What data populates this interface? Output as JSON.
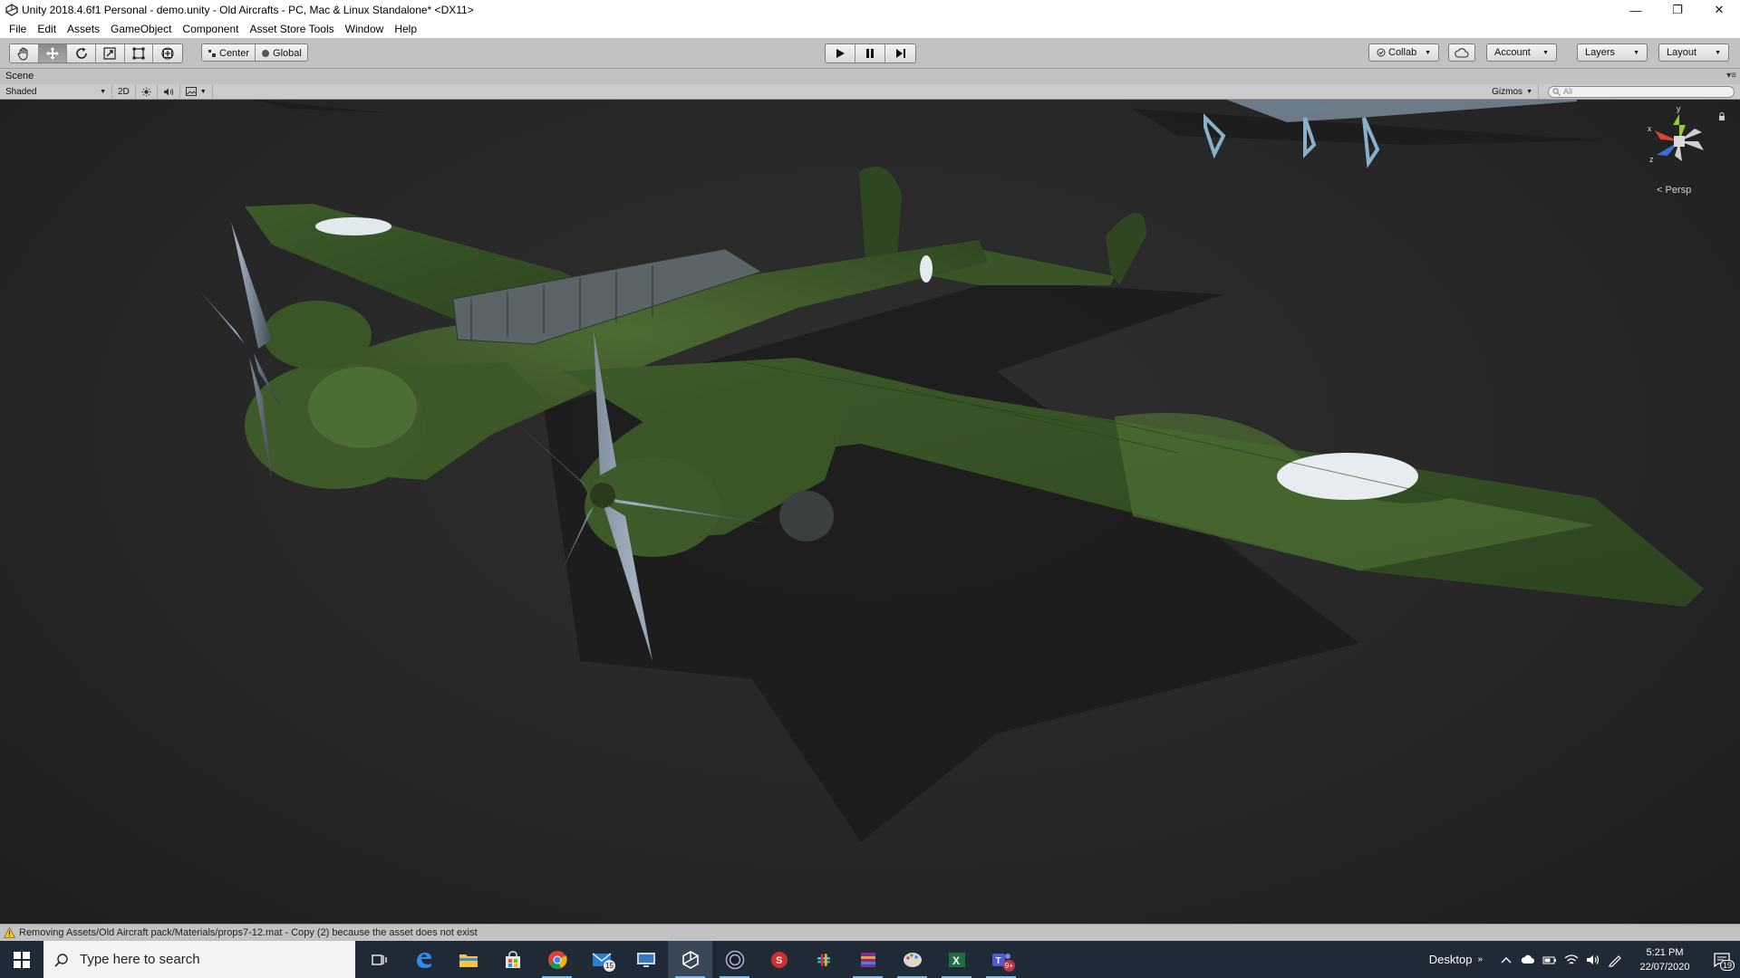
{
  "window": {
    "title": "Unity 2018.4.6f1 Personal - demo.unity - Old Aircrafts - PC, Mac & Linux Standalone* <DX11>",
    "minimize_glyph": "—",
    "restore_glyph": "❐",
    "close_glyph": "✕"
  },
  "menu": [
    "File",
    "Edit",
    "Assets",
    "GameObject",
    "Component",
    "Asset Store Tools",
    "Window",
    "Help"
  ],
  "toolbar": {
    "tools": [
      "hand-tool",
      "move-tool",
      "rotate-tool",
      "scale-tool",
      "rect-tool",
      "transform-tool"
    ],
    "active_tool": "move-tool",
    "pivot_label": "Center",
    "space_label": "Global",
    "collab_label": "Collab",
    "account_label": "Account",
    "layers_label": "Layers",
    "layout_label": "Layout"
  },
  "scene_panel": {
    "tab_label": "Scene",
    "shading_mode": "Shaded",
    "mode_2d": "2D",
    "gizmos_label": "Gizmos",
    "search_placeholder": "All",
    "projection_label": "Persp",
    "gizmo_axes": {
      "y": "y",
      "x": "x",
      "z": "z"
    }
  },
  "colors": {
    "toolbar_bg": "#c2c2c2",
    "viewport_bg": "#2a2a2a",
    "aircraft_green": "#3e5a2a",
    "roundel": "#e6ecef",
    "taskbar_bg": "#1f2a36",
    "gizmo_x": "#d8433a",
    "gizmo_y": "#8fcb3e",
    "gizmo_z": "#3b6fd6"
  },
  "status_bar": {
    "message": "Removing Assets/Old Aircraft pack/Materials/props7-12.mat - Copy (2) because the asset does not exist"
  },
  "taskbar": {
    "search_placeholder": "Type here to search",
    "apps": [
      {
        "name": "task-view",
        "badge": ""
      },
      {
        "name": "edge",
        "badge": ""
      },
      {
        "name": "file-explorer",
        "badge": ""
      },
      {
        "name": "store",
        "badge": ""
      },
      {
        "name": "chrome",
        "badge": ""
      },
      {
        "name": "mail",
        "badge": "15"
      },
      {
        "name": "remote-desktop",
        "badge": ""
      },
      {
        "name": "unity",
        "badge": ""
      },
      {
        "name": "cinema4d",
        "badge": ""
      },
      {
        "name": "substance",
        "badge": ""
      },
      {
        "name": "slack",
        "badge": ""
      },
      {
        "name": "winrar",
        "badge": ""
      },
      {
        "name": "paint",
        "badge": ""
      },
      {
        "name": "excel",
        "badge": ""
      },
      {
        "name": "teams",
        "badge": "9+"
      }
    ],
    "desktop_label": "Desktop",
    "tray_chevron": "»",
    "time": "5:21 PM",
    "date": "22/07/2020",
    "notification_count": "19"
  }
}
